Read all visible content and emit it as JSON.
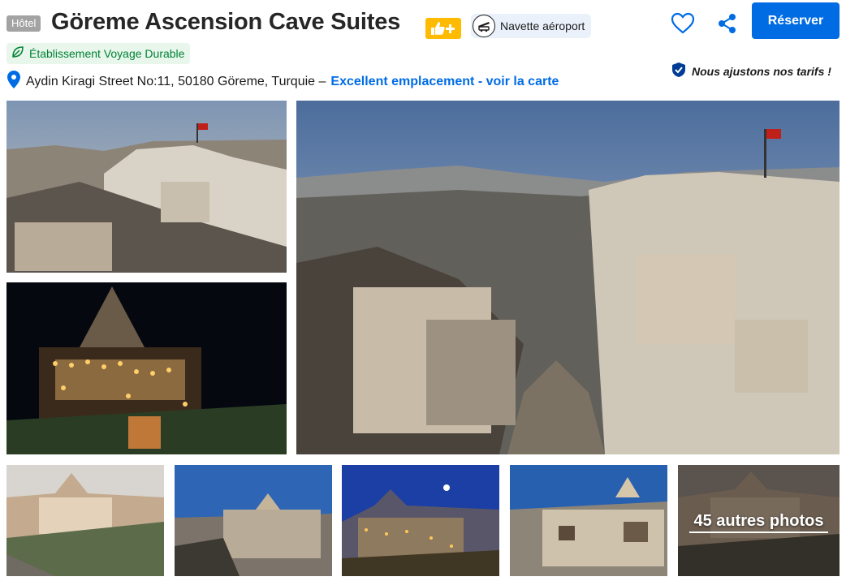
{
  "header": {
    "type_badge": "Hôtel",
    "title": "Göreme Ascension Cave Suites",
    "thumb_badge_icon": "thumbs-up-plus-icon",
    "shuttle_label": "Navette aéroport",
    "shuttle_icon": "shuttle-icon",
    "favorite_icon": "heart-icon",
    "share_icon": "share-icon",
    "reserve_label": "Réserver",
    "eco_label": "Établissement Voyage Durable",
    "eco_icon": "leaf-icon",
    "price_note": "Nous ajustons nos tarifs !",
    "price_note_icon": "shield-check-icon"
  },
  "address": {
    "pin_icon": "map-pin-icon",
    "text": "Aydin Kiragi Street No:11, 50180 Göreme, Turquie –",
    "link": "Excellent emplacement - voir la carte"
  },
  "gallery": {
    "more_photos_label": "45 autres photos"
  },
  "colors": {
    "brand_blue": "#006ce4",
    "genius_yellow": "#febb02",
    "eco_green": "#008234",
    "eco_bg": "#e8f6ec",
    "pill_bg": "#eaf1fb"
  }
}
